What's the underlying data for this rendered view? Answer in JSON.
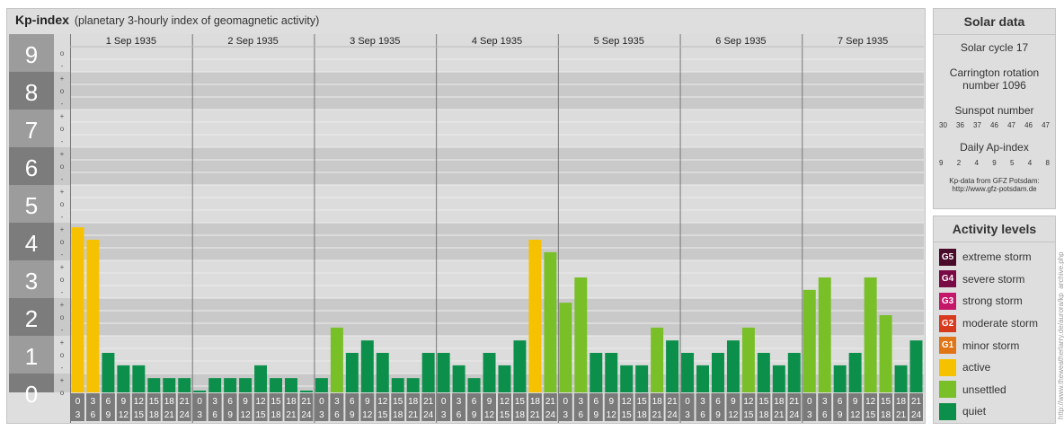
{
  "header": {
    "title": "Kp-index",
    "subtitle": "(planetary 3-hourly index of geomagnetic activity)"
  },
  "solar": {
    "title": "Solar data",
    "cycle": "Solar cycle 17",
    "carrington_line1": "Carrington rotation",
    "carrington_line2": "number 1096",
    "sunspot_label": "Sunspot number",
    "sunspot_values": [
      "30",
      "36",
      "37",
      "46",
      "47",
      "46",
      "47"
    ],
    "ap_label": "Daily Ap-index",
    "ap_values": [
      "9",
      "2",
      "4",
      "9",
      "5",
      "4",
      "8"
    ],
    "credit_line1": "Kp-data from GFZ Potsdam:",
    "credit_line2": "http://www.gfz-potsdam.de"
  },
  "levels": {
    "title": "Activity levels",
    "items": [
      {
        "code": "G5",
        "label": "extreme storm",
        "color": "#4a0b2a"
      },
      {
        "code": "G4",
        "label": "severe storm",
        "color": "#7a0a45"
      },
      {
        "code": "G3",
        "label": "strong storm",
        "color": "#c4176a"
      },
      {
        "code": "G2",
        "label": "moderate storm",
        "color": "#d83a1e"
      },
      {
        "code": "G1",
        "label": "minor storm",
        "color": "#e07518"
      },
      {
        "code": "",
        "label": "active",
        "color": "#f6c200"
      },
      {
        "code": "",
        "label": "unsettled",
        "color": "#79bf28"
      },
      {
        "code": "",
        "label": "quiet",
        "color": "#0c8f4a"
      }
    ]
  },
  "watermark": "http://www.theweatherlarry.de/aurora/kp_archive.php",
  "chart_data": {
    "type": "bar",
    "title": "Kp-index",
    "subtitle": "(planetary 3-hourly index of geomagnetic activity)",
    "ylim": [
      0,
      9
    ],
    "y_ticks": [
      "0",
      "1",
      "2",
      "3",
      "4",
      "5",
      "6",
      "7",
      "8",
      "9"
    ],
    "y_minor_labels": [
      "-",
      "o",
      "+"
    ],
    "days": [
      "1 Sep 1935",
      "2 Sep 1935",
      "3 Sep 1935",
      "4 Sep 1935",
      "5 Sep 1935",
      "6 Sep 1935",
      "7 Sep 1935"
    ],
    "interval_top": [
      "0",
      "3",
      "6",
      "9",
      "12",
      "15",
      "18",
      "21"
    ],
    "interval_bottom": [
      "3",
      "6",
      "9",
      "12",
      "15",
      "18",
      "21",
      "24"
    ],
    "values": [
      [
        4.33,
        4.0,
        1.0,
        0.67,
        0.67,
        0.33,
        0.33,
        0.33
      ],
      [
        0.0,
        0.33,
        0.33,
        0.33,
        0.67,
        0.33,
        0.33,
        0.0
      ],
      [
        0.33,
        1.67,
        1.0,
        1.33,
        1.0,
        0.33,
        0.33,
        1.0
      ],
      [
        1.0,
        0.67,
        0.33,
        1.0,
        0.67,
        1.33,
        4.0,
        3.67
      ],
      [
        2.33,
        3.0,
        1.0,
        1.0,
        0.67,
        0.67,
        1.67,
        1.33
      ],
      [
        1.0,
        0.67,
        1.0,
        1.33,
        1.67,
        1.0,
        0.67,
        1.0
      ],
      [
        2.67,
        3.0,
        0.67,
        1.0,
        3.0,
        2.0,
        0.67,
        1.33
      ]
    ],
    "colors": {
      "quiet": "#0c8f4a",
      "unsettled": "#79bf28",
      "active": "#f6c200"
    }
  }
}
